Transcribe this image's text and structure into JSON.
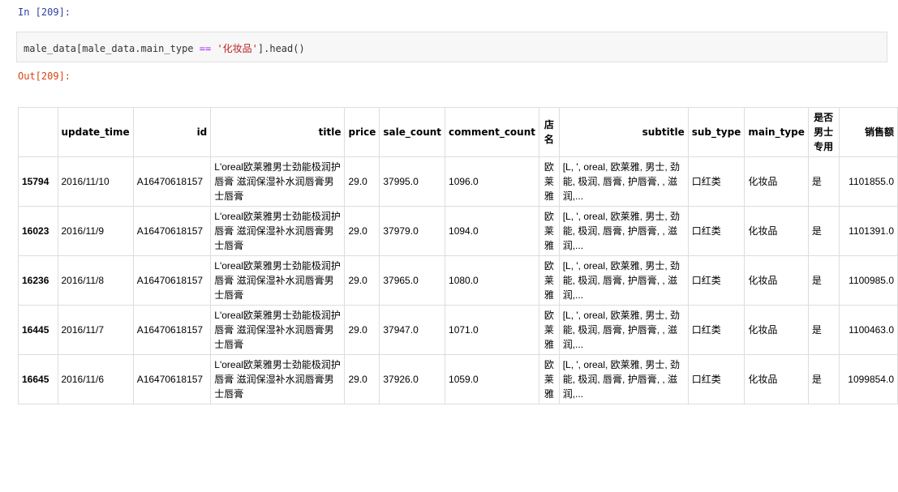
{
  "cell": {
    "in_prompt": "In [209]:",
    "out_prompt": "Out[209]:",
    "code_prefix": "male_data[male_data.main_type ",
    "code_op": "==",
    "code_space": " ",
    "code_str": "'化妆品'",
    "code_suffix": "].head()"
  },
  "table": {
    "columns": [
      "",
      "update_time",
      "id",
      "title",
      "price",
      "sale_count",
      "comment_count",
      "店名",
      "subtitle",
      "sub_type",
      "main_type",
      "是否男士专用",
      "销售额"
    ],
    "rows": [
      {
        "index": "15794",
        "update_time": "2016/11/10",
        "id": "A16470618157",
        "title": "L'oreal欧莱雅男士劲能极润护唇膏 滋润保湿补水润唇膏男士唇膏",
        "price": "29.0",
        "sale_count": "37995.0",
        "comment_count": "1096.0",
        "shop": "欧莱雅",
        "subtitle": "[L, ', oreal, 欧莱雅, 男士, 劲能, 极润, 唇膏, 护唇膏, , 滋润,...",
        "sub_type": "口红类",
        "main_type": "化妆品",
        "male": "是",
        "sales": "1101855.0"
      },
      {
        "index": "16023",
        "update_time": "2016/11/9",
        "id": "A16470618157",
        "title": "L'oreal欧莱雅男士劲能极润护唇膏 滋润保湿补水润唇膏男士唇膏",
        "price": "29.0",
        "sale_count": "37979.0",
        "comment_count": "1094.0",
        "shop": "欧莱雅",
        "subtitle": "[L, ', oreal, 欧莱雅, 男士, 劲能, 极润, 唇膏, 护唇膏, , 滋润,...",
        "sub_type": "口红类",
        "main_type": "化妆品",
        "male": "是",
        "sales": "1101391.0"
      },
      {
        "index": "16236",
        "update_time": "2016/11/8",
        "id": "A16470618157",
        "title": "L'oreal欧莱雅男士劲能极润护唇膏 滋润保湿补水润唇膏男士唇膏",
        "price": "29.0",
        "sale_count": "37965.0",
        "comment_count": "1080.0",
        "shop": "欧莱雅",
        "subtitle": "[L, ', oreal, 欧莱雅, 男士, 劲能, 极润, 唇膏, 护唇膏, , 滋润,...",
        "sub_type": "口红类",
        "main_type": "化妆品",
        "male": "是",
        "sales": "1100985.0"
      },
      {
        "index": "16445",
        "update_time": "2016/11/7",
        "id": "A16470618157",
        "title": "L'oreal欧莱雅男士劲能极润护唇膏 滋润保湿补水润唇膏男士唇膏",
        "price": "29.0",
        "sale_count": "37947.0",
        "comment_count": "1071.0",
        "shop": "欧莱雅",
        "subtitle": "[L, ', oreal, 欧莱雅, 男士, 劲能, 极润, 唇膏, 护唇膏, , 滋润,...",
        "sub_type": "口红类",
        "main_type": "化妆品",
        "male": "是",
        "sales": "1100463.0"
      },
      {
        "index": "16645",
        "update_time": "2016/11/6",
        "id": "A16470618157",
        "title": "L'oreal欧莱雅男士劲能极润护唇膏 滋润保湿补水润唇膏男士唇膏",
        "price": "29.0",
        "sale_count": "37926.0",
        "comment_count": "1059.0",
        "shop": "欧莱雅",
        "subtitle": "[L, ', oreal, 欧莱雅, 男士, 劲能, 极润, 唇膏, 护唇膏, , 滋润,...",
        "sub_type": "口红类",
        "main_type": "化妆品",
        "male": "是",
        "sales": "1099854.0"
      }
    ]
  }
}
